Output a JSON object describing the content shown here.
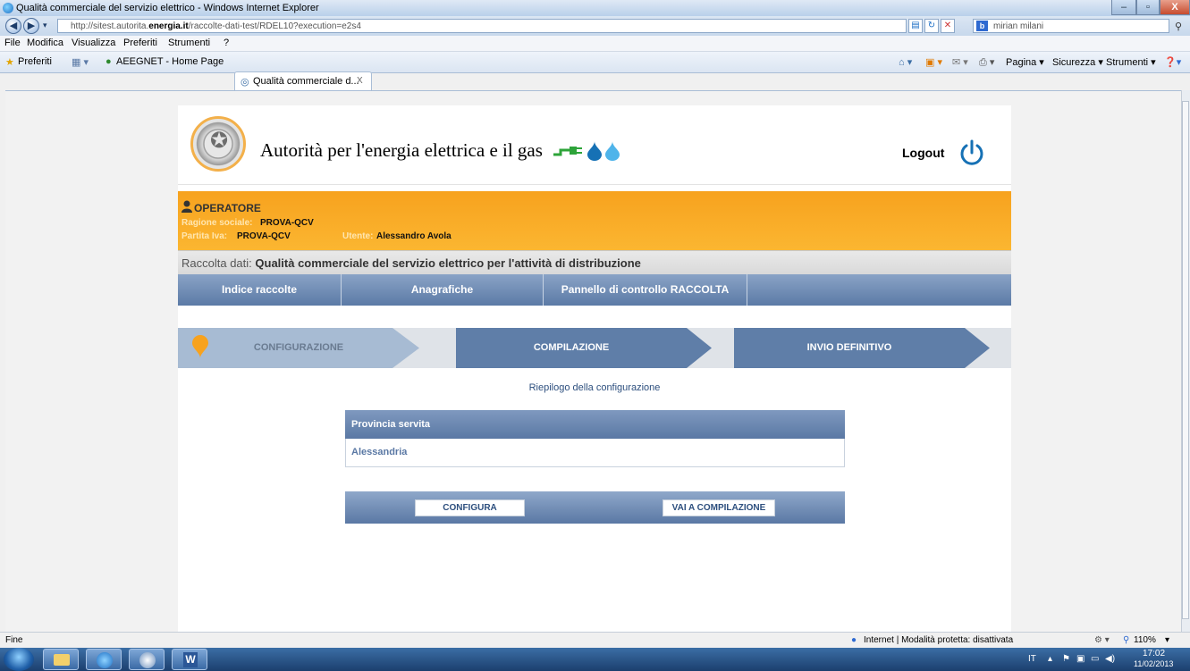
{
  "window": {
    "title": "Qualità commerciale del servizio elettrico - Windows Internet Explorer",
    "min": "–",
    "max": "▫",
    "close": "X"
  },
  "address": {
    "url_prefix": "http://sitest.autorita.",
    "url_domain": "energia.it",
    "url_suffix": "/raccolte-dati-test/RDEL10?execution=e2s4",
    "search_text": "mirian milani"
  },
  "menu": [
    "File",
    "Modifica",
    "Visualizza",
    "Preferiti",
    "Strumenti",
    "?"
  ],
  "favorites": {
    "label": "Preferiti",
    "link": "AEEGNET - Home Page",
    "active_tab": "Qualità commerciale d...",
    "tab_close": "X"
  },
  "commandbar": [
    "Pagina ▾",
    "Sicurezza ▾",
    "Strumenti ▾"
  ],
  "header": {
    "org_name": "Autorità per l'energia elettrica e il gas",
    "logout": "Logout"
  },
  "operator": {
    "title": "OPERATORE",
    "ragione_label": "Ragione sociale:",
    "ragione_value": "PROVA-QCV",
    "piva_label": "Partita Iva:",
    "piva_value": "PROVA-QCV",
    "utente_label": "Utente:",
    "utente_value": "Alessandro Avola"
  },
  "raccolta": {
    "label": "Raccolta dati:",
    "value": "Qualità commerciale del servizio elettrico per l'attività di distribuzione"
  },
  "nav": [
    "Indice raccolte",
    "Anagrafiche",
    "Pannello di controllo RACCOLTA"
  ],
  "steps": [
    "CONFIGURAZIONE",
    "COMPILAZIONE",
    "INVIO DEFINITIVO"
  ],
  "riepilogo": "Riepilogo della configurazione",
  "table": {
    "header": "Provincia servita",
    "rows": [
      "Alessandria"
    ]
  },
  "actions": {
    "configura": "CONFIGURA",
    "compilazione": "VAI A COMPILAZIONE"
  },
  "status": {
    "left": "Fine",
    "zone": "Internet | Modalità protetta: disattivata",
    "zoom": "110%"
  },
  "taskbar": {
    "lang": "IT",
    "time": "17:02",
    "date": "11/02/2013"
  },
  "colors": {
    "accent_orange": "#f7a21e",
    "nav_blue": "#5b7aa6"
  }
}
